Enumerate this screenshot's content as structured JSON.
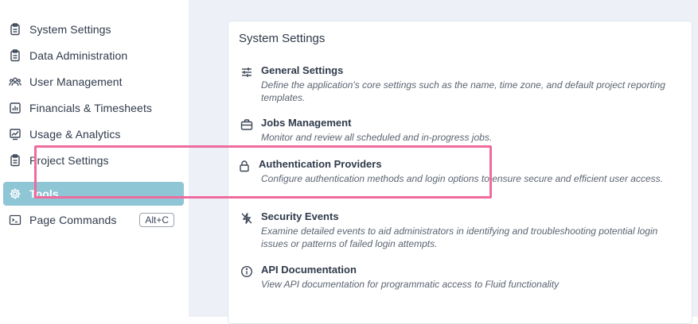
{
  "sidebar": {
    "items": [
      {
        "label": "System Settings",
        "icon": "clipboard-icon"
      },
      {
        "label": "Data Administration",
        "icon": "clipboard-icon"
      },
      {
        "label": "User Management",
        "icon": "users-icon"
      },
      {
        "label": "Financials & Timesheets",
        "icon": "bar-chart-icon"
      },
      {
        "label": "Usage & Analytics",
        "icon": "trend-chart-icon"
      },
      {
        "label": "Project Settings",
        "icon": "clipboard-icon"
      },
      {
        "label": "Tools",
        "icon": "gear-icon",
        "active": true
      },
      {
        "label": "Page Commands",
        "icon": "terminal-icon",
        "shortcut": "Alt+C"
      }
    ]
  },
  "main": {
    "card_title": "System Settings",
    "entries": [
      {
        "title": "General Settings",
        "icon": "sliders-icon",
        "description": "Define the application's core settings such as the name, time zone, and default project reporting templates."
      },
      {
        "title": "Jobs Management",
        "icon": "briefcase-icon",
        "description": "Monitor and review all scheduled and in-progress jobs."
      },
      {
        "title": "Authentication Providers",
        "icon": "lock-icon",
        "description": "Configure authentication methods and login options to ensure secure and efficient user access.",
        "highlighted": true
      },
      {
        "title": "Security Events",
        "icon": "security-events-icon",
        "description": "Examine detailed events to aid administrators in identifying and troubleshooting potential login issues or patterns of failed login attempts."
      },
      {
        "title": "API Documentation",
        "icon": "info-icon",
        "description": "View API documentation for programmatic access to Fluid functionality"
      }
    ]
  },
  "colors": {
    "active_item_bg": "#8ec6d6",
    "main_bg": "#edf1f7",
    "highlight_border": "#ef6b9e"
  }
}
